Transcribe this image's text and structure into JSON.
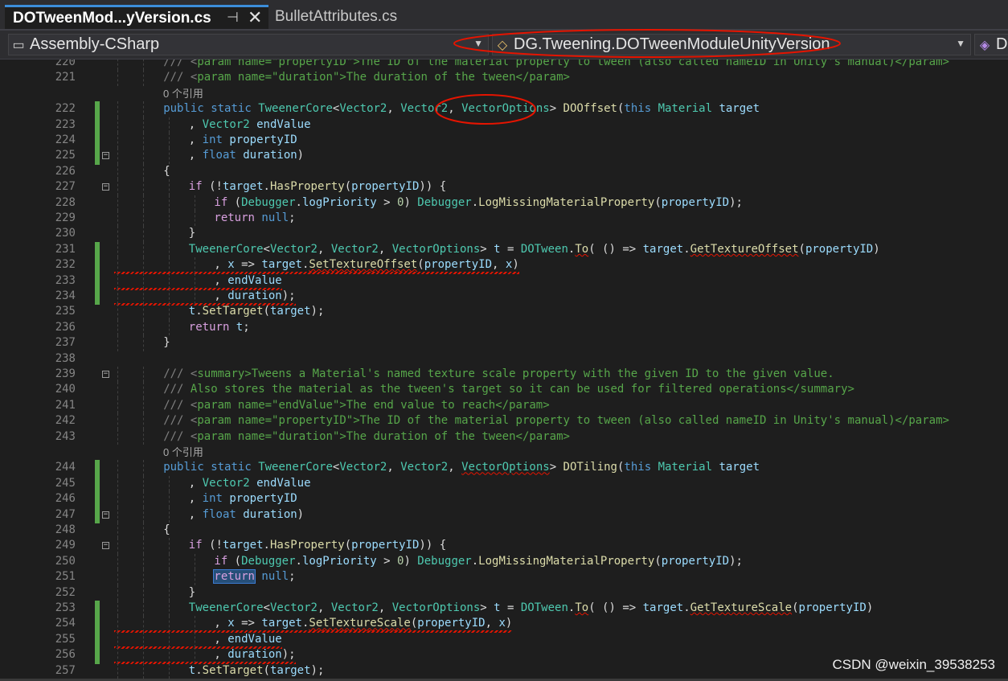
{
  "tabs": [
    {
      "label": "DOTweenMod...yVersion.cs",
      "pin": "⊣",
      "close": "✕"
    },
    {
      "label": "BulletAttributes.cs"
    }
  ],
  "navbar": {
    "project": "Assembly-CSharp",
    "type": "DG.Tweening.DOTweenModuleUnityVersion",
    "member": "D"
  },
  "colors": {
    "keyword": "#569cd6",
    "type": "#4ec9b0",
    "comment": "#57a64a",
    "change_bar": "#57a64a",
    "annotation": "#e51400"
  },
  "code_lines": [
    {
      "n": "220",
      "ind": 4,
      "tok": [
        [
          "xt",
          "/// <"
        ],
        [
          "cm",
          "param name=\"propertyID\">The ID of the material property to tween (also called nameID in Unity's manual)</param>"
        ]
      ]
    },
    {
      "n": "221",
      "ind": 4,
      "tok": [
        [
          "xt",
          "/// <"
        ],
        [
          "cm",
          "param name=\""
        ],
        [
          "cm",
          "duration"
        ],
        [
          "cm",
          "\">The duration of the tween</param>"
        ]
      ]
    },
    {
      "ref": "0 个引用"
    },
    {
      "n": "222",
      "ind": 4,
      "tok": [
        [
          "kw",
          "public static "
        ],
        [
          "ty",
          "TweenerCore"
        ],
        [
          "",
          "<"
        ],
        [
          "ty",
          "Vector2"
        ],
        [
          "",
          ", "
        ],
        [
          "ty",
          "Vector2"
        ],
        [
          "",
          ", "
        ],
        [
          "ty",
          "VectorOptions"
        ],
        [
          "",
          "> "
        ],
        [
          "fn",
          "DOOffset"
        ],
        [
          "",
          "("
        ],
        [
          "kw",
          "this "
        ],
        [
          "ty",
          "Material"
        ],
        [
          "",
          ""
        ],
        [
          "pr",
          " target"
        ]
      ]
    },
    {
      "n": "223",
      "ind": 6,
      "tok": [
        [
          "",
          ", "
        ],
        [
          "ty",
          "Vector2"
        ],
        [
          "pr",
          " endValue"
        ]
      ]
    },
    {
      "n": "224",
      "ind": 6,
      "tok": [
        [
          "",
          ", "
        ],
        [
          "kw",
          "int"
        ],
        [
          "pr",
          " propertyID"
        ]
      ]
    },
    {
      "n": "225",
      "ind": 6,
      "tok": [
        [
          "",
          ", "
        ],
        [
          "kw",
          "float"
        ],
        [
          "pr",
          " duration"
        ],
        [
          "",
          ")"
        ]
      ]
    },
    {
      "n": "226",
      "ind": 4,
      "tok": [
        [
          "",
          "{"
        ]
      ]
    },
    {
      "n": "227",
      "ind": 6,
      "tok": [
        [
          "cf",
          "if"
        ],
        [
          "",
          " (!"
        ],
        [
          "pr",
          "target"
        ],
        [
          "",
          "."
        ],
        [
          "fn",
          "HasProperty"
        ],
        [
          "",
          "("
        ],
        [
          "pr",
          "propertyID"
        ],
        [
          "",
          "))"
        ],
        [
          "",
          " {"
        ]
      ]
    },
    {
      "n": "228",
      "ind": 8,
      "tok": [
        [
          "cf",
          "if"
        ],
        [
          "",
          " ("
        ],
        [
          "ty",
          "Debugger"
        ],
        [
          "",
          "."
        ],
        [
          "pr",
          "logPriority"
        ],
        [
          "",
          " > "
        ],
        [
          "nm",
          "0"
        ],
        [
          "",
          ") "
        ],
        [
          "ty",
          "Debugger"
        ],
        [
          "",
          "."
        ],
        [
          "fn",
          "LogMissingMaterialProperty"
        ],
        [
          "",
          "("
        ],
        [
          "pr",
          "propertyID"
        ],
        [
          "",
          ");"
        ]
      ]
    },
    {
      "n": "229",
      "ind": 8,
      "tok": [
        [
          "cf",
          "return"
        ],
        [
          "",
          " "
        ],
        [
          "kw",
          "null"
        ],
        [
          "",
          ";"
        ]
      ]
    },
    {
      "n": "230",
      "ind": 6,
      "tok": [
        [
          "",
          "}"
        ]
      ]
    },
    {
      "n": "231",
      "ind": 6,
      "tok": [
        [
          "ty",
          "TweenerCore"
        ],
        [
          "",
          "<"
        ],
        [
          "ty",
          "Vector2"
        ],
        [
          "",
          ", "
        ],
        [
          "ty",
          "Vector2"
        ],
        [
          "",
          ", "
        ],
        [
          "ty",
          "VectorOptions"
        ],
        [
          "",
          "> "
        ],
        [
          "pr",
          "t"
        ],
        [
          "",
          " = "
        ],
        [
          "ty",
          "DOTween"
        ],
        [
          "",
          "."
        ],
        [
          "fn",
          "To"
        ],
        [
          "",
          "( () => "
        ],
        [
          "pr",
          "target"
        ],
        [
          "",
          "."
        ],
        [
          "fn",
          "GetTextureOffset"
        ],
        [
          "",
          "("
        ],
        [
          "pr",
          "propertyID"
        ],
        [
          "",
          ")"
        ]
      ]
    },
    {
      "n": "232",
      "ind": 8,
      "tok": [
        [
          "",
          ", "
        ],
        [
          "pr",
          "x"
        ],
        [
          "",
          " => "
        ],
        [
          "pr",
          "target"
        ],
        [
          "",
          "."
        ],
        [
          "fn",
          "SetTextureOffset"
        ],
        [
          "",
          "("
        ],
        [
          "pr",
          "propertyID"
        ],
        [
          "",
          ", "
        ],
        [
          "pr",
          "x"
        ],
        [
          "",
          ")"
        ]
      ]
    },
    {
      "n": "233",
      "ind": 8,
      "tok": [
        [
          "",
          ", "
        ],
        [
          "pr",
          "endValue"
        ]
      ]
    },
    {
      "n": "234",
      "ind": 8,
      "tok": [
        [
          "",
          ", "
        ],
        [
          "pr",
          "duration"
        ],
        [
          "",
          ");"
        ]
      ]
    },
    {
      "n": "235",
      "ind": 6,
      "tok": [
        [
          "pr",
          "t"
        ],
        [
          "",
          "."
        ],
        [
          "fn",
          "SetTarget"
        ],
        [
          "",
          "("
        ],
        [
          "pr",
          "target"
        ],
        [
          "",
          ");"
        ]
      ]
    },
    {
      "n": "236",
      "ind": 6,
      "tok": [
        [
          "cf",
          "return"
        ],
        [
          "pr",
          " t"
        ],
        [
          "",
          ";"
        ]
      ]
    },
    {
      "n": "237",
      "ind": 4,
      "tok": [
        [
          "",
          "}"
        ]
      ]
    },
    {
      "n": "238",
      "ind": 0,
      "tok": []
    },
    {
      "n": "239",
      "ind": 4,
      "tok": [
        [
          "xt",
          "/// <"
        ],
        [
          "cm",
          "summary>Tweens a Material's named texture scale property with the given ID to the given value."
        ]
      ]
    },
    {
      "n": "240",
      "ind": 4,
      "tok": [
        [
          "xt",
          "/// "
        ],
        [
          "cm",
          "Also stores the material as the tween's target so it can be used for filtered operations</summary>"
        ]
      ]
    },
    {
      "n": "241",
      "ind": 4,
      "tok": [
        [
          "xt",
          "/// <"
        ],
        [
          "cm",
          "param name=\""
        ],
        [
          "cm",
          "endValue"
        ],
        [
          "cm",
          "\">The end value to reach</param>"
        ]
      ]
    },
    {
      "n": "242",
      "ind": 4,
      "tok": [
        [
          "xt",
          "/// <"
        ],
        [
          "cm",
          "param name=\""
        ],
        [
          "cm",
          "propertyID"
        ],
        [
          "cm",
          "\">The ID of the material property to tween (also called nameID in Unity's manual)</param>"
        ]
      ]
    },
    {
      "n": "243",
      "ind": 4,
      "tok": [
        [
          "xt",
          "/// <"
        ],
        [
          "cm",
          "param name=\""
        ],
        [
          "cm",
          "duration"
        ],
        [
          "cm",
          "\">The duration of the tween</param>"
        ]
      ]
    },
    {
      "ref": "0 个引用"
    },
    {
      "n": "244",
      "ind": 4,
      "tok": [
        [
          "kw",
          "public static "
        ],
        [
          "ty",
          "TweenerCore"
        ],
        [
          "",
          "<"
        ],
        [
          "ty",
          "Vector2"
        ],
        [
          "",
          ", "
        ],
        [
          "ty",
          "Vector2"
        ],
        [
          "",
          ", "
        ],
        [
          "ty",
          "VectorOptions"
        ],
        [
          "",
          "> "
        ],
        [
          "fn",
          "DOTiling"
        ],
        [
          "",
          "("
        ],
        [
          "kw",
          "this "
        ],
        [
          "ty",
          "Material"
        ],
        [
          "pr",
          " target"
        ]
      ]
    },
    {
      "n": "245",
      "ind": 6,
      "tok": [
        [
          "",
          ", "
        ],
        [
          "ty",
          "Vector2"
        ],
        [
          "pr",
          " endValue"
        ]
      ]
    },
    {
      "n": "246",
      "ind": 6,
      "tok": [
        [
          "",
          ", "
        ],
        [
          "kw",
          "int"
        ],
        [
          "pr",
          " propertyID"
        ]
      ]
    },
    {
      "n": "247",
      "ind": 6,
      "tok": [
        [
          "",
          ", "
        ],
        [
          "kw",
          "float"
        ],
        [
          "pr",
          " duration"
        ],
        [
          "",
          ")"
        ]
      ]
    },
    {
      "n": "248",
      "ind": 4,
      "tok": [
        [
          "",
          "{"
        ]
      ]
    },
    {
      "n": "249",
      "ind": 6,
      "tok": [
        [
          "cf",
          "if"
        ],
        [
          "",
          " (!"
        ],
        [
          "pr",
          "target"
        ],
        [
          "",
          "."
        ],
        [
          "fn",
          "HasProperty"
        ],
        [
          "",
          "("
        ],
        [
          "pr",
          "propertyID"
        ],
        [
          "",
          "))"
        ],
        [
          "",
          " {"
        ]
      ]
    },
    {
      "n": "250",
      "ind": 8,
      "tok": [
        [
          "cf",
          "if"
        ],
        [
          "",
          " ("
        ],
        [
          "ty",
          "Debugger"
        ],
        [
          "",
          "."
        ],
        [
          "pr",
          "logPriority"
        ],
        [
          "",
          " > "
        ],
        [
          "nm",
          "0"
        ],
        [
          "",
          ") "
        ],
        [
          "ty",
          "Debugger"
        ],
        [
          "",
          "."
        ],
        [
          "fn",
          "LogMissingMaterialProperty"
        ],
        [
          "",
          "("
        ],
        [
          "pr",
          "propertyID"
        ],
        [
          "",
          ");"
        ]
      ]
    },
    {
      "n": "251",
      "ind": 8,
      "tok": [
        [
          "cf",
          "return"
        ],
        [
          "",
          " "
        ],
        [
          "kw",
          "null"
        ],
        [
          "",
          ";"
        ]
      ]
    },
    {
      "n": "252",
      "ind": 6,
      "tok": [
        [
          "",
          "}"
        ]
      ]
    },
    {
      "n": "253",
      "ind": 6,
      "tok": [
        [
          "ty",
          "TweenerCore"
        ],
        [
          "",
          "<"
        ],
        [
          "ty",
          "Vector2"
        ],
        [
          "",
          ", "
        ],
        [
          "ty",
          "Vector2"
        ],
        [
          "",
          ", "
        ],
        [
          "ty",
          "VectorOptions"
        ],
        [
          "",
          "> "
        ],
        [
          "pr",
          "t"
        ],
        [
          "",
          " = "
        ],
        [
          "ty",
          "DOTween"
        ],
        [
          "",
          "."
        ],
        [
          "fn",
          "To"
        ],
        [
          "",
          "( () => "
        ],
        [
          "pr",
          "target"
        ],
        [
          "",
          "."
        ],
        [
          "fn",
          "GetTextureScale"
        ],
        [
          "",
          "("
        ],
        [
          "pr",
          "propertyID"
        ],
        [
          "",
          ")"
        ]
      ]
    },
    {
      "n": "254",
      "ind": 8,
      "tok": [
        [
          "",
          ", "
        ],
        [
          "pr",
          "x"
        ],
        [
          "",
          " => "
        ],
        [
          "pr",
          "target"
        ],
        [
          "",
          "."
        ],
        [
          "fn",
          "SetTextureScale"
        ],
        [
          "",
          "("
        ],
        [
          "pr",
          "propertyID"
        ],
        [
          "",
          ", "
        ],
        [
          "pr",
          "x"
        ],
        [
          "",
          ")"
        ]
      ]
    },
    {
      "n": "255",
      "ind": 8,
      "tok": [
        [
          "",
          ", "
        ],
        [
          "pr",
          "endValue"
        ]
      ]
    },
    {
      "n": "256",
      "ind": 8,
      "tok": [
        [
          "",
          ", "
        ],
        [
          "pr",
          "duration"
        ],
        [
          "",
          ");"
        ]
      ]
    },
    {
      "n": "257",
      "ind": 6,
      "tok": [
        [
          "pr",
          "t"
        ],
        [
          "",
          "."
        ],
        [
          "fn",
          "SetTarget"
        ],
        [
          "",
          "("
        ],
        [
          "pr",
          "target"
        ],
        [
          "",
          ");"
        ]
      ]
    }
  ],
  "watermark": "CSDN @weixin_39538253"
}
